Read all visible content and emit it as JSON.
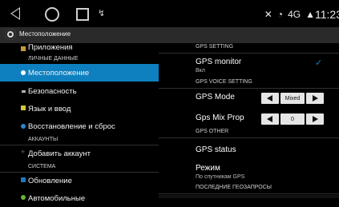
{
  "statusbar": {
    "extra_icon": "↯",
    "clock": "11:23",
    "network_label": "4G"
  },
  "actionbar": {
    "title": "Местоположение"
  },
  "left": {
    "items": [
      {
        "label": "Приложения"
      },
      {
        "label": "ЛИЧНЫЕ ДАННЫЕ"
      },
      {
        "label": "Местоположение"
      },
      {
        "label": "Безопасность"
      },
      {
        "label": "Язык и ввод"
      },
      {
        "label": "Восстановление и сброс"
      },
      {
        "label": "АККАУНТЫ"
      },
      {
        "label": "Добавить аккаунт"
      },
      {
        "label": "СИСТЕМА"
      },
      {
        "label": "Обновление"
      },
      {
        "label": "Автомобильные"
      }
    ]
  },
  "right": {
    "gps_setting_header": "GPS SETTING",
    "gps_monitor_title": "GPS monitor",
    "gps_monitor_sub": "Вкл",
    "gps_voice_header": "GPS VOICE SETTING",
    "gps_mode_label": "GPS Mode",
    "gps_mode_value": "Mixed",
    "gps_mix_label": "Gps Mix Prop",
    "gps_mix_value": "0",
    "gps_other_header": "GPS OTHER",
    "gps_status_label": "GPS status",
    "mode_title": "Режим",
    "mode_sub": "По спутникам GPS",
    "recent_header": "ПОСЛЕДНИЕ ГЕОЗАПРОСЫ"
  },
  "colors": {
    "accent": "#0e80bf",
    "bg": "#000000",
    "actionbar": "#2a2a2a"
  }
}
